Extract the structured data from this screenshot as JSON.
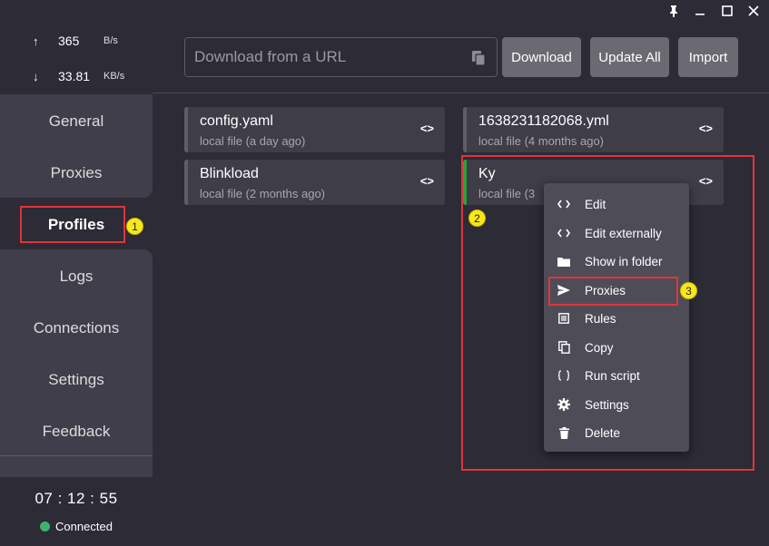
{
  "titlebar": {
    "pin_icon": "pin-icon",
    "minimize_icon": "minimize-icon",
    "maximize_icon": "maximize-icon",
    "close_icon": "close-icon"
  },
  "sidebar": {
    "upload": {
      "arrow": "↑",
      "value": "365",
      "unit": "B/s"
    },
    "download": {
      "arrow": "↓",
      "value": "33.81",
      "unit": "KB/s"
    },
    "items": [
      {
        "label": "General"
      },
      {
        "label": "Proxies"
      },
      {
        "label": "Profiles"
      },
      {
        "label": "Logs"
      },
      {
        "label": "Connections"
      },
      {
        "label": "Settings"
      },
      {
        "label": "Feedback"
      }
    ],
    "active_item": "Profiles",
    "clock": "07 : 12 : 55",
    "status": "Connected",
    "status_color": "#3bb36b"
  },
  "main": {
    "url_placeholder": "Download from a URL",
    "buttons": {
      "download": "Download",
      "update_all": "Update All",
      "import": "Import"
    },
    "profiles": [
      {
        "title": "config.yaml",
        "subtitle": "local file (a day ago)",
        "code": "<>"
      },
      {
        "title": "1638231182068.yml",
        "subtitle": "local file (4 months ago)",
        "code": "<>"
      },
      {
        "title": "Blinkload",
        "subtitle": "local file (2 months ago)",
        "code": "<>"
      },
      {
        "title": "Ky",
        "subtitle": "local file (3",
        "code": "<>",
        "selected": true
      }
    ]
  },
  "context_menu": {
    "items": [
      {
        "label": "Edit",
        "icon": "code-icon"
      },
      {
        "label": "Edit externally",
        "icon": "code-icon"
      },
      {
        "label": "Show in folder",
        "icon": "folder-icon"
      },
      {
        "label": "Proxies",
        "icon": "send-icon"
      },
      {
        "label": "Rules",
        "icon": "list-icon"
      },
      {
        "label": "Copy",
        "icon": "copy-icon"
      },
      {
        "label": "Run script",
        "icon": "braces-icon"
      },
      {
        "label": "Settings",
        "icon": "gear-icon"
      },
      {
        "label": "Delete",
        "icon": "trash-icon"
      }
    ]
  },
  "annotations": {
    "badge_1": "1",
    "badge_2": "2",
    "badge_3": "3",
    "highlight_color": "#e0343b",
    "badge_color": "#f8e71c"
  },
  "colors": {
    "background": "#2c2b36",
    "panel": "#3f3e4a",
    "card": "#3e3d48",
    "button": "#6b6a72",
    "menu": "#4e4d57",
    "selected_bar": "#27a33a"
  }
}
